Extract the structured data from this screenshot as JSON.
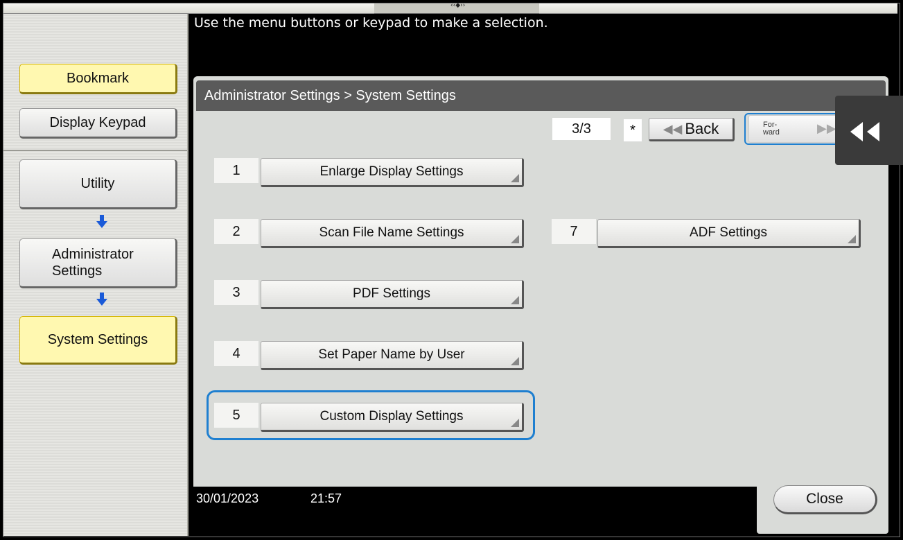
{
  "topbar": {
    "handle": "‹‹◆››"
  },
  "instruction": "Use the menu buttons or keypad to make a selection.",
  "sidebar": {
    "bookmark": "Bookmark",
    "display_keypad": "Display Keypad",
    "utility": "Utility",
    "admin_settings": "Administrator Settings",
    "system_settings": "System Settings"
  },
  "panel": {
    "breadcrumb": "Administrator Settings > System Settings",
    "pager": "3/3",
    "star": "*",
    "back_label": "Back",
    "forward_label": "For-\nward",
    "items": [
      {
        "num": "1",
        "label": "Enlarge Display Settings"
      },
      {
        "num": "2",
        "label": "Scan File Name Settings"
      },
      {
        "num": "3",
        "label": "PDF Settings"
      },
      {
        "num": "4",
        "label": "Set Paper Name by User"
      },
      {
        "num": "5",
        "label": "Custom Display Settings"
      },
      {
        "num": "7",
        "label": "ADF Settings"
      }
    ]
  },
  "footer": {
    "date": "30/01/2023",
    "time": "21:57",
    "close_label": "Close"
  },
  "colors": {
    "highlight_yellow": "#fff8b0",
    "focus_blue": "#1e7fd0",
    "arrow_blue": "#1a5ad8"
  }
}
